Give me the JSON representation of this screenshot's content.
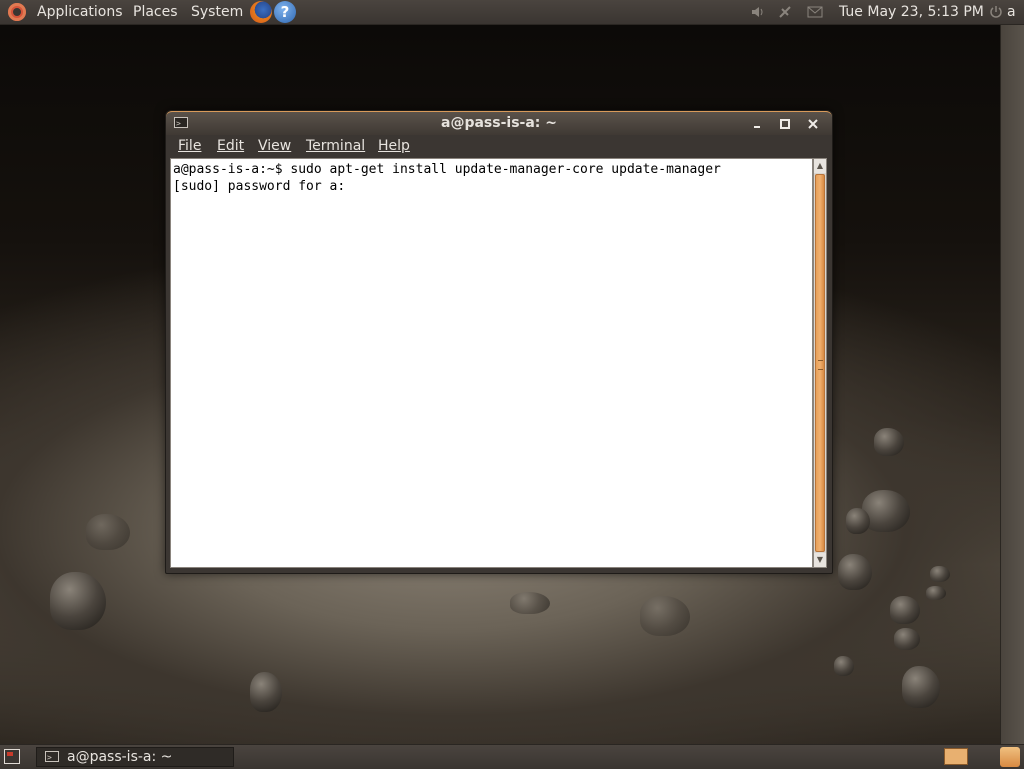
{
  "top_panel": {
    "applications": "Applications",
    "places": "Places",
    "system": "System",
    "help_glyph": "?",
    "clock": "Tue May 23,  5:13 PM",
    "user": "a",
    "icons": [
      "ubuntu-logo-icon",
      "firefox-icon",
      "help-icon",
      "volume-icon",
      "network-icon",
      "mail-icon",
      "power-icon"
    ]
  },
  "window": {
    "title": "a@pass-is-a: ~",
    "menu": [
      {
        "label": "File"
      },
      {
        "label": "Edit"
      },
      {
        "label": "View"
      },
      {
        "label": "Terminal"
      },
      {
        "label": "Help"
      }
    ],
    "terminal_lines": [
      "a@pass-is-a:~$ sudo apt-get install update-manager-core update-manager",
      "[sudo] password for a: "
    ]
  },
  "bottom_panel": {
    "task_label": "a@pass-is-a: ~"
  }
}
